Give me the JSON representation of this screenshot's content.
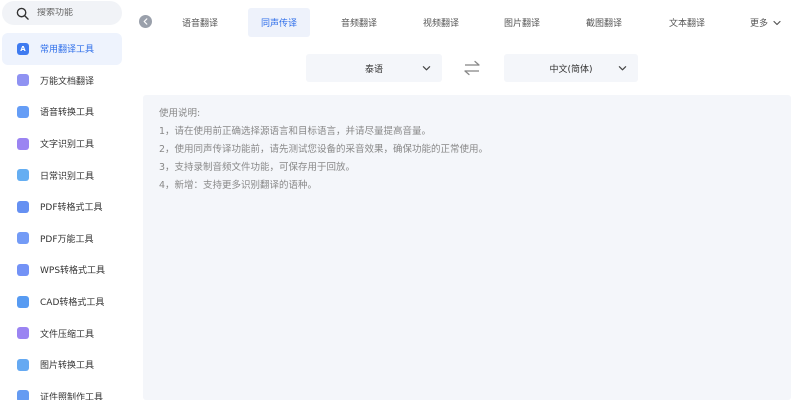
{
  "sidebar": {
    "search_placeholder": "搜索功能",
    "items": [
      {
        "label": "常用翻译工具",
        "icon": "a-letter-icon",
        "color": "#3f7bf0",
        "active": true
      },
      {
        "label": "万能文档翻译",
        "icon": "document-stack-icon",
        "color": "#7b7ff0"
      },
      {
        "label": "语音转换工具",
        "icon": "music-note-icon",
        "color": "#4a8cf5"
      },
      {
        "label": "文字识别工具",
        "icon": "text-cursor-icon",
        "color": "#8a6ff0"
      },
      {
        "label": "日常识别工具",
        "icon": "camera-scan-icon",
        "color": "#4aa0f0"
      },
      {
        "label": "PDF转格式工具",
        "icon": "pdf-arrow-icon",
        "color": "#4a7cf0"
      },
      {
        "label": "PDF万能工具",
        "icon": "pdf-list-icon",
        "color": "#5b8af5"
      },
      {
        "label": "WPS转格式工具",
        "icon": "wps-arrow-icon",
        "color": "#5a7ff5"
      },
      {
        "label": "CAD转格式工具",
        "icon": "cad-compass-icon",
        "color": "#3a8af0"
      },
      {
        "label": "文件压缩工具",
        "icon": "zip-compress-icon",
        "color": "#8a6ff0"
      },
      {
        "label": "图片转换工具",
        "icon": "image-icon",
        "color": "#4a9af0"
      },
      {
        "label": "证件照制作工具",
        "icon": "id-photo-icon",
        "color": "#4a8af0"
      }
    ]
  },
  "tabs": [
    {
      "label": "语音翻译"
    },
    {
      "label": "同声传译",
      "active": true
    },
    {
      "label": "音频翻译"
    },
    {
      "label": "视频翻译"
    },
    {
      "label": "图片翻译"
    },
    {
      "label": "截图翻译"
    },
    {
      "label": "文本翻译"
    }
  ],
  "more_label": "更多",
  "source_lang": "泰语",
  "target_lang": "中文(简体)",
  "instructions": {
    "title": "使用说明:",
    "lines": [
      "1，请在使用前正确选择源语言和目标语言，并请尽量提高音量。",
      "2，使用同声传译功能前，请先测试您设备的采音效果，确保功能的正常使用。",
      "3，支持录制音频文件功能，可保存用于回放。",
      "4，新增：支持更多识别翻译的语种。"
    ]
  },
  "colors": {
    "accent": "#2f6fea",
    "panel_bg": "#f4f6fa",
    "active_bg": "#eef3fd"
  }
}
